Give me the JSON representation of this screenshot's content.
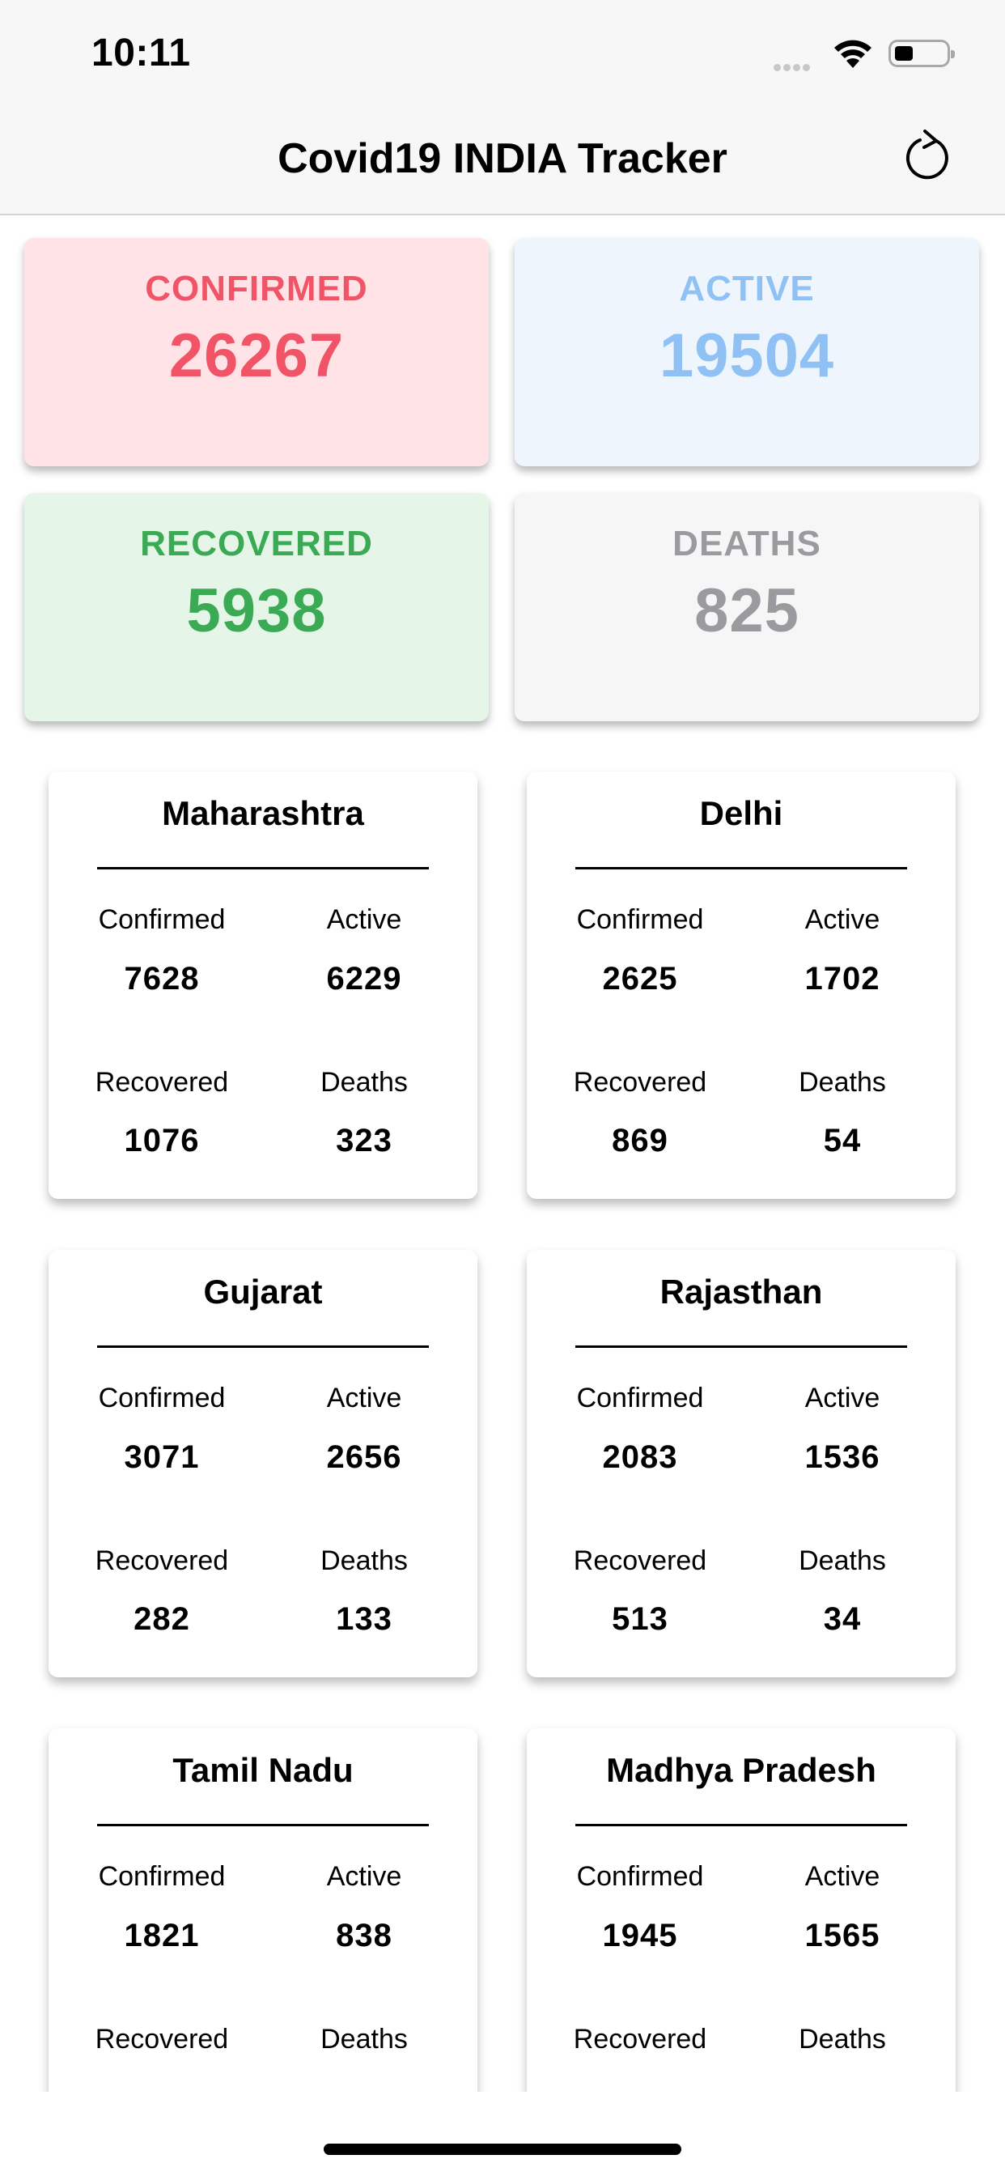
{
  "status_bar": {
    "time": "10:11"
  },
  "nav": {
    "title": "Covid19 INDIA Tracker",
    "refresh_icon": "refresh-icon"
  },
  "summary": {
    "confirmed": {
      "label": "CONFIRMED",
      "value": "26267",
      "color": "#f25467"
    },
    "active": {
      "label": "ACTIVE",
      "value": "19504",
      "color": "#8fc1f4"
    },
    "recovered": {
      "label": "RECOVERED",
      "value": "5938",
      "color": "#3aaa55"
    },
    "deaths": {
      "label": "DEATHS",
      "value": "825",
      "color": "#9b9b9f"
    }
  },
  "labels": {
    "confirmed": "Confirmed",
    "active": "Active",
    "recovered": "Recovered",
    "deaths": "Deaths"
  },
  "states": [
    {
      "name": "Maharashtra",
      "confirmed": "7628",
      "active": "6229",
      "recovered": "1076",
      "deaths": "323"
    },
    {
      "name": "Delhi",
      "confirmed": "2625",
      "active": "1702",
      "recovered": "869",
      "deaths": "54"
    },
    {
      "name": "Gujarat",
      "confirmed": "3071",
      "active": "2656",
      "recovered": "282",
      "deaths": "133"
    },
    {
      "name": "Rajasthan",
      "confirmed": "2083",
      "active": "1536",
      "recovered": "513",
      "deaths": "34"
    },
    {
      "name": "Tamil Nadu",
      "confirmed": "1821",
      "active": "838",
      "recovered": "",
      "deaths": ""
    },
    {
      "name": "Madhya Pradesh",
      "confirmed": "1945",
      "active": "1565",
      "recovered": "",
      "deaths": ""
    }
  ]
}
